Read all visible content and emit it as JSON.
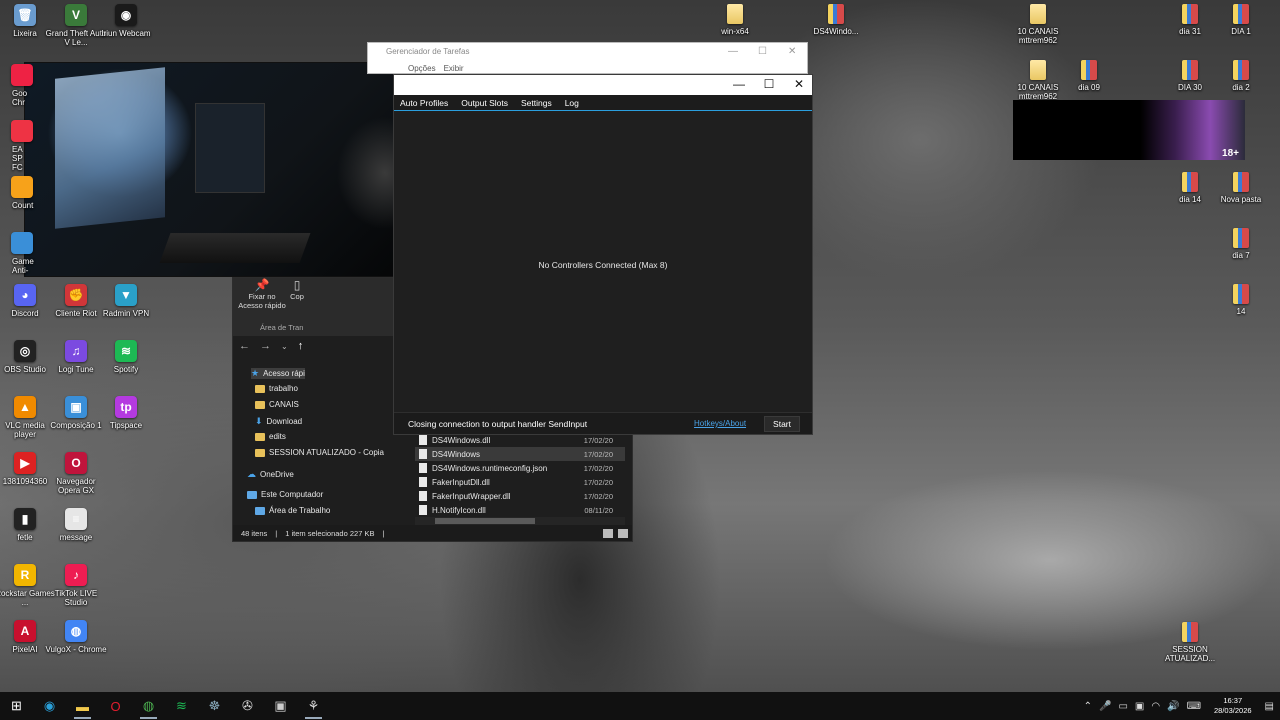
{
  "desktop": {
    "left_icons": [
      {
        "label": "Lixeira",
        "color": "#6a9ccf",
        "glyph": "🗑",
        "icon": "recycle-bin-icon"
      },
      {
        "label": "Grand Theft Auto V Le...",
        "color": "#3a7a3a",
        "glyph": "V",
        "icon": "gta-icon"
      },
      {
        "label": "Iriun Webcam",
        "color": "#1a1a1a",
        "glyph": "◉",
        "icon": "webcam-icon"
      },
      {
        "label": "Discord",
        "color": "#5865f2",
        "glyph": "◕",
        "icon": "discord-icon"
      },
      {
        "label": "Cliente Riot",
        "color": "#d13639",
        "glyph": "✊",
        "icon": "riot-icon"
      },
      {
        "label": "Radmin VPN",
        "color": "#2aa0c8",
        "glyph": "▼",
        "icon": "vpn-icon"
      },
      {
        "label": "OBS Studio",
        "color": "#222",
        "glyph": "◎",
        "icon": "obs-icon"
      },
      {
        "label": "Logi Tune",
        "color": "#7b4ae0",
        "glyph": "♫",
        "icon": "logi-tune-icon"
      },
      {
        "label": "Spotify",
        "color": "#1db954",
        "glyph": "≋",
        "icon": "spotify-icon"
      },
      {
        "label": "VLC media player",
        "color": "#f08a00",
        "glyph": "▲",
        "icon": "vlc-icon"
      },
      {
        "label": "Composição 1",
        "color": "#3a8fd8",
        "glyph": "▣",
        "icon": "document-icon"
      },
      {
        "label": "Tipspace",
        "color": "#b43ae0",
        "glyph": "tp",
        "icon": "tipspace-icon"
      },
      {
        "label": "1381094360",
        "color": "#d22",
        "glyph": "▶",
        "icon": "video-icon"
      },
      {
        "label": "Navegador Opera GX",
        "color": "#c0143c",
        "glyph": "O",
        "icon": "opera-gx-icon"
      },
      {
        "label": "fetle",
        "color": "#222",
        "glyph": "▮",
        "icon": "file-icon"
      },
      {
        "label": "message",
        "color": "#e6e6e6",
        "glyph": "≡",
        "icon": "text-file-icon"
      },
      {
        "label": "Rockstar Games ...",
        "color": "#f2b600",
        "glyph": "R",
        "icon": "rockstar-icon"
      },
      {
        "label": "TikTok LIVE Studio",
        "color": "#ee1d52",
        "glyph": "♪",
        "icon": "tiktok-icon"
      },
      {
        "label": "PixelAI",
        "color": "#c8102e",
        "glyph": "A",
        "icon": "pixelai-icon"
      },
      {
        "label": "VulgoX - Chrome",
        "color": "#4285f4",
        "glyph": "◍",
        "icon": "chrome-icon"
      }
    ],
    "partial_icons": [
      {
        "label": "Goo Chr",
        "color": "#e24",
        "icon": "chrome-partial-icon"
      },
      {
        "label": "EA SP FC",
        "color": "#e34",
        "icon": "ea-partial-icon"
      },
      {
        "label": "Count",
        "color": "#f7a21a",
        "icon": "counter-strike-partial-icon"
      },
      {
        "label": "Game Anti-",
        "color": "#3a8fd8",
        "icon": "game-partial-icon"
      }
    ],
    "right_icons": [
      {
        "label": "win-x64",
        "type": "folder",
        "icon": "folder-icon"
      },
      {
        "label": "DS4Windo...",
        "type": "zip",
        "icon": "zip-icon"
      },
      {
        "label": "10 CANAIS mttrem962",
        "type": "folder",
        "icon": "folder-icon"
      },
      {
        "label": "dia 31",
        "type": "zip",
        "icon": "zip-icon"
      },
      {
        "label": "DIA 1",
        "type": "zip",
        "icon": "zip-icon"
      },
      {
        "label": "10 CANAIS mttrem962",
        "type": "folder",
        "icon": "folder-icon"
      },
      {
        "label": "dia 09",
        "type": "zip",
        "icon": "zip-icon"
      },
      {
        "label": "DIA 30",
        "type": "zip",
        "icon": "zip-icon"
      },
      {
        "label": "dia 2",
        "type": "zip",
        "icon": "zip-icon"
      },
      {
        "label": "dia 14",
        "type": "zip",
        "icon": "zip-icon"
      },
      {
        "label": "Nova pasta",
        "type": "zip",
        "icon": "zip-icon"
      },
      {
        "label": "dia 7",
        "type": "zip",
        "icon": "zip-icon"
      },
      {
        "label": "14",
        "type": "zip",
        "icon": "zip-icon"
      },
      {
        "label": "SESSION ATUALIZAD...",
        "type": "zip",
        "icon": "zip-icon"
      }
    ],
    "ad_badge": "18+"
  },
  "task_manager": {
    "title": "Gerenciador de Tarefas",
    "menu": [
      "Opções",
      "Exibir"
    ]
  },
  "ds4windows": {
    "tabs": [
      "Auto Profiles",
      "Output Slots",
      "Settings",
      "Log"
    ],
    "empty_message": "No Controllers Connected (Max 8)",
    "status": "Closing connection to output handler SendInput",
    "hotkeys_link": "Hotkeys/About",
    "start_button": "Start"
  },
  "explorer": {
    "ribbon": {
      "pin_label": "Fixar no Acesso rápido",
      "copy_label": "Cop",
      "group_label": "Área de Tran"
    },
    "tree": [
      {
        "label": "Acesso rápi",
        "kind": "star",
        "selected": true
      },
      {
        "label": "trabalho",
        "kind": "folder"
      },
      {
        "label": "CANAIS",
        "kind": "folder"
      },
      {
        "label": "Download",
        "kind": "download"
      },
      {
        "label": "edits",
        "kind": "folder"
      },
      {
        "label": "SESSION ATUALIZADO - Copia",
        "kind": "folder"
      },
      {
        "label": "OneDrive",
        "kind": "cloud"
      },
      {
        "label": "Este Computador",
        "kind": "pc"
      },
      {
        "label": "Área de Trabalho",
        "kind": "desktop"
      }
    ],
    "files": [
      {
        "name": "DS4Windows.dll",
        "date": "17/02/20"
      },
      {
        "name": "DS4Windows",
        "date": "17/02/20",
        "selected": true
      },
      {
        "name": "DS4Windows.runtimeconfig.json",
        "date": "17/02/20"
      },
      {
        "name": "FakerInputDll.dll",
        "date": "17/02/20"
      },
      {
        "name": "FakerInputWrapper.dll",
        "date": "17/02/20"
      },
      {
        "name": "H.NotifyIcon.dll",
        "date": "08/11/20"
      }
    ],
    "status": {
      "count": "48 itens",
      "selection": "1 item selecionado  227 KB"
    }
  },
  "taskbar": {
    "items": [
      {
        "icon": "windows-start-icon",
        "glyph": "⊞",
        "color": "#fff"
      },
      {
        "icon": "edge-icon",
        "glyph": "◉",
        "color": "#2a9fd8"
      },
      {
        "icon": "file-explorer-icon",
        "glyph": "▬",
        "color": "#f2c94c",
        "active": true
      },
      {
        "icon": "opera-icon",
        "glyph": "O",
        "color": "#e21d2e"
      },
      {
        "icon": "chrome-icon",
        "glyph": "◍",
        "color": "#4caf50",
        "active": true
      },
      {
        "icon": "spotify-icon",
        "glyph": "≋",
        "color": "#1db954"
      },
      {
        "icon": "steam-icon",
        "glyph": "☸",
        "color": "#8ab"
      },
      {
        "icon": "rockstar-icon",
        "glyph": "✇",
        "color": "#ddd"
      },
      {
        "icon": "window-icon",
        "glyph": "▣",
        "color": "#ccc"
      },
      {
        "icon": "ds4windows-icon",
        "glyph": "⚘",
        "color": "#ddd",
        "active": true
      }
    ],
    "time": "16:37",
    "date": "28/03/2026"
  }
}
